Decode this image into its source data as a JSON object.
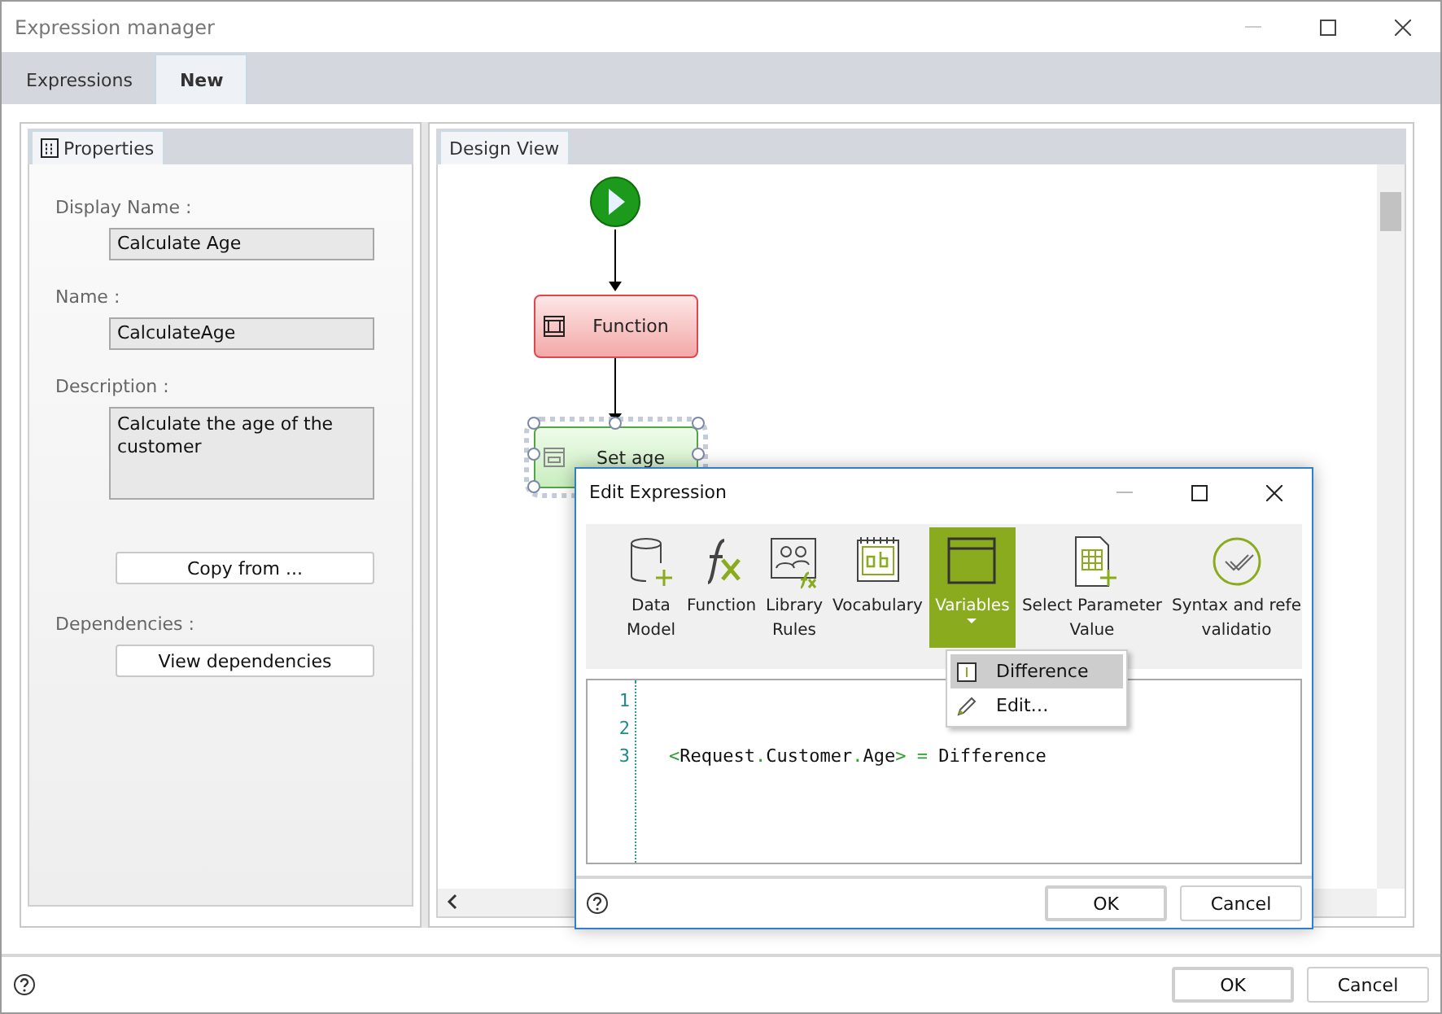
{
  "window": {
    "title": "Expression manager"
  },
  "tabs": [
    {
      "label": "Expressions",
      "selected": false
    },
    {
      "label": "New",
      "selected": true
    }
  ],
  "properties": {
    "tab": "Properties",
    "fields": [
      {
        "label": "Display Name :",
        "value": "Calculate Age",
        "kind": "input"
      },
      {
        "label": "Name :",
        "value": "CalculateAge",
        "kind": "input"
      },
      {
        "label": "Description :",
        "value": "Calculate the age of the customer",
        "kind": "textarea"
      }
    ],
    "copy_button": "Copy from ...",
    "dependencies_label": "Dependencies :",
    "dependencies_button": "View dependencies"
  },
  "design_view": {
    "tab": "Design View",
    "nodes": [
      {
        "kind": "start"
      },
      {
        "kind": "function",
        "label": "Function",
        "selected": false
      },
      {
        "kind": "set",
        "label": "Set age",
        "selected": true
      }
    ]
  },
  "footer": {
    "buttons": [
      "OK",
      "Cancel"
    ]
  },
  "dialog": {
    "title": "Edit Expression",
    "toolbar": [
      {
        "kind": "data-model",
        "lines": [
          "Data",
          "Model"
        ],
        "selected": false
      },
      {
        "kind": "function",
        "lines": [
          "Function"
        ],
        "selected": false
      },
      {
        "kind": "library",
        "lines": [
          "Library",
          "Rules"
        ],
        "selected": false
      },
      {
        "kind": "vocabulary",
        "lines": [
          "Vocabulary"
        ],
        "selected": false
      },
      {
        "kind": "variables",
        "lines": [
          "Variables"
        ],
        "selected": true
      },
      {
        "kind": "parameter",
        "lines": [
          "Select Parameter",
          "Value"
        ],
        "selected": false
      },
      {
        "kind": "validation",
        "lines": [
          "Syntax and refe",
          "validatio"
        ],
        "selected": false
      }
    ],
    "menu": [
      {
        "kind": "variable",
        "label": "Difference",
        "selected": true
      },
      {
        "kind": "edit",
        "label": "Edit…",
        "selected": false
      }
    ],
    "code": [
      {
        "number": "1"
      },
      {
        "number": "2"
      },
      {
        "number": "3",
        "text": "<Request.Customer.Age> = Difference"
      }
    ],
    "buttons": [
      "OK",
      "Cancel"
    ]
  }
}
